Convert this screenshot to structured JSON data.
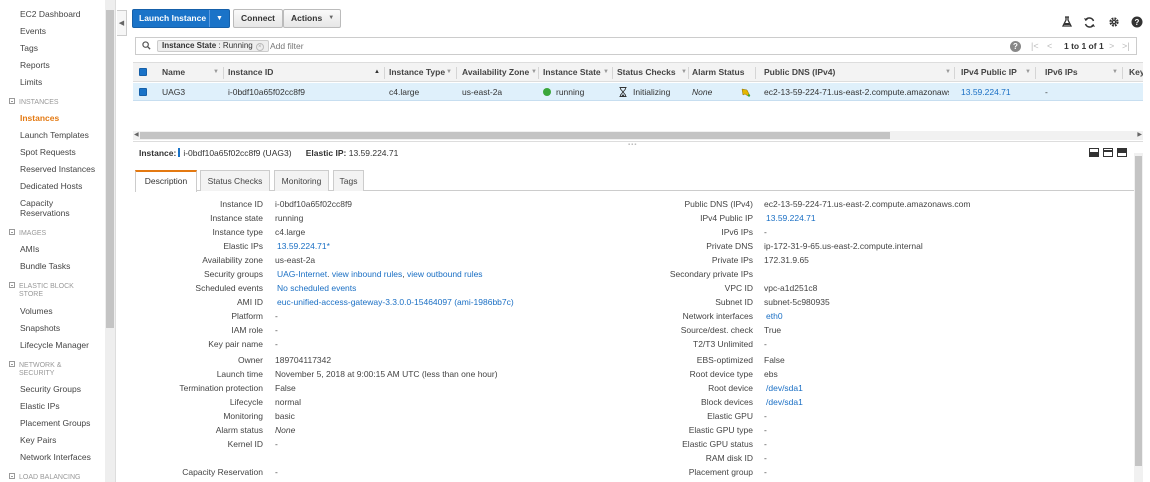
{
  "sidebar": {
    "items": [
      {
        "label": "EC2 Dashboard"
      },
      {
        "label": "Events"
      },
      {
        "label": "Tags"
      },
      {
        "label": "Reports"
      },
      {
        "label": "Limits"
      }
    ],
    "sections": [
      {
        "title": "INSTANCES",
        "items": [
          "Instances",
          "Launch Templates",
          "Spot Requests",
          "Reserved Instances",
          "Dedicated Hosts",
          "Capacity Reservations"
        ]
      },
      {
        "title": "IMAGES",
        "items": [
          "AMIs",
          "Bundle Tasks"
        ]
      },
      {
        "title": "ELASTIC BLOCK STORE",
        "items": [
          "Volumes",
          "Snapshots",
          "Lifecycle Manager"
        ]
      },
      {
        "title": "NETWORK & SECURITY",
        "items": [
          "Security Groups",
          "Elastic IPs",
          "Placement Groups",
          "Key Pairs",
          "Network Interfaces"
        ]
      },
      {
        "title": "LOAD BALANCING",
        "items": []
      }
    ],
    "active_item": "Instances"
  },
  "toolbar": {
    "launch_label": "Launch Instance",
    "connect_label": "Connect",
    "actions_label": "Actions"
  },
  "filter": {
    "chip_key": "Instance State",
    "chip_value": "Running",
    "placeholder": "Add filter",
    "pager_text": "1 to 1 of 1"
  },
  "table": {
    "columns": [
      "Name",
      "Instance ID",
      "Instance Type",
      "Availability Zone",
      "Instance State",
      "Status Checks",
      "Alarm Status",
      "Public DNS (IPv4)",
      "IPv4 Public IP",
      "IPv6 IPs",
      "Key"
    ],
    "rows": [
      {
        "name": "UAG3",
        "instance_id": "i-0bdf10a65f02cc8f9",
        "instance_type": "c4.large",
        "availability_zone": "us-east-2a",
        "instance_state": "running",
        "status_checks": "Initializing",
        "alarm_status": "None",
        "public_dns": "ec2-13-59-224-71.us-east-2.compute.amazonaws....",
        "ipv4_public_ip": "13.59.224.71",
        "ipv6_ips": "-"
      }
    ]
  },
  "detail": {
    "instance_label": "Instance:",
    "instance_value": "i-0bdf10a65f02cc8f9 (UAG3)",
    "elastic_label": "Elastic IP:",
    "elastic_value": "13.59.224.71",
    "tabs": [
      "Description",
      "Status Checks",
      "Monitoring",
      "Tags"
    ],
    "left_fields": [
      {
        "label": "Instance ID",
        "value": "i-0bdf10a65f02cc8f9"
      },
      {
        "label": "Instance state",
        "value": "running"
      },
      {
        "label": "Instance type",
        "value": "c4.large"
      },
      {
        "label": "Elastic IPs",
        "value": "13.59.224.71*"
      },
      {
        "label": "Availability zone",
        "value": "us-east-2a"
      },
      {
        "label": "Security groups",
        "value": "UAG-Internet",
        "extra1": "view inbound rules",
        "extra2": "view outbound rules"
      },
      {
        "label": "Scheduled events",
        "value": "No scheduled events"
      },
      {
        "label": "AMI ID",
        "value": "euc-unified-access-gateway-3.3.0.0-15464097 (ami-1986bb7c)"
      },
      {
        "label": "Platform",
        "value": "-"
      },
      {
        "label": "IAM role",
        "value": "-"
      },
      {
        "label": "Key pair name",
        "value": "-"
      },
      {
        "label": "Owner",
        "value": "189704117342"
      },
      {
        "label": "Launch time",
        "value": "November 5, 2018 at 9:00:15 AM UTC (less than one hour)"
      },
      {
        "label": "Termination protection",
        "value": "False"
      },
      {
        "label": "Lifecycle",
        "value": "normal"
      },
      {
        "label": "Monitoring",
        "value": "basic"
      },
      {
        "label": "Alarm status",
        "value": "None"
      },
      {
        "label": "Kernel ID",
        "value": "-"
      },
      {
        "label": "Capacity Reservation",
        "value": "-"
      }
    ],
    "right_fields": [
      {
        "label": "Public DNS (IPv4)",
        "value": "ec2-13-59-224-71.us-east-2.compute.amazonaws.com"
      },
      {
        "label": "IPv4 Public IP",
        "value": "13.59.224.71"
      },
      {
        "label": "IPv6 IPs",
        "value": "-"
      },
      {
        "label": "Private DNS",
        "value": "ip-172-31-9-65.us-east-2.compute.internal"
      },
      {
        "label": "Private IPs",
        "value": "172.31.9.65"
      },
      {
        "label": "Secondary private IPs",
        "value": ""
      },
      {
        "label": "VPC ID",
        "value": "vpc-a1d251c8"
      },
      {
        "label": "Subnet ID",
        "value": "subnet-5c980935"
      },
      {
        "label": "Network interfaces",
        "value": "eth0"
      },
      {
        "label": "Source/dest. check",
        "value": "True"
      },
      {
        "label": "T2/T3 Unlimited",
        "value": "-"
      },
      {
        "label": "EBS-optimized",
        "value": "False"
      },
      {
        "label": "Root device type",
        "value": "ebs"
      },
      {
        "label": "Root device",
        "value": "/dev/sda1"
      },
      {
        "label": "Block devices",
        "value": "/dev/sda1"
      },
      {
        "label": "Elastic GPU",
        "value": "-"
      },
      {
        "label": "Elastic GPU type",
        "value": "-"
      },
      {
        "label": "Elastic GPU status",
        "value": "-"
      },
      {
        "label": "RAM disk ID",
        "value": "-"
      },
      {
        "label": "Placement group",
        "value": "-"
      }
    ]
  },
  "colors": {
    "accent_orange": "#e47911",
    "primary_blue": "#1a73c8",
    "link_blue": "#1a6fc4",
    "running_green": "#3aa63a",
    "row_selected": "#dff0fb"
  }
}
